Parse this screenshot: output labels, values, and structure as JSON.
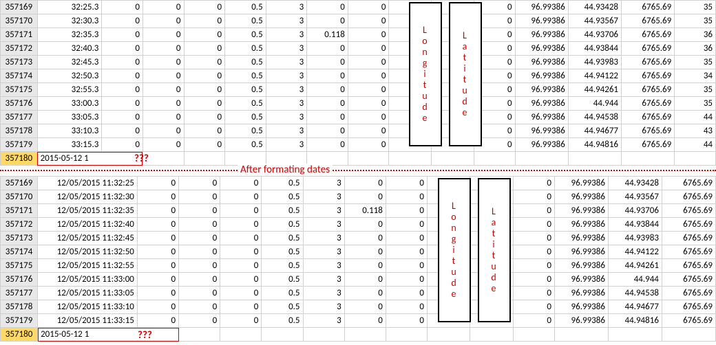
{
  "labels": {
    "after_formatting": "After formating dates",
    "longitude": "Longitude",
    "latitude": "Latitude",
    "question": "???"
  },
  "top": {
    "rows": [
      {
        "r": "357169",
        "t": "32:25.3",
        "a": "0",
        "b": "0",
        "c": "0",
        "d": "0.5",
        "e": "3",
        "f": "0",
        "g": "0",
        "h": "",
        "i": "",
        "j": "0",
        "k": "96.99386",
        "l": "44.93428",
        "m": "6765.69",
        "n": "35"
      },
      {
        "r": "357170",
        "t": "32:30.3",
        "a": "0",
        "b": "0",
        "c": "0",
        "d": "0.5",
        "e": "3",
        "f": "0",
        "g": "0",
        "h": "",
        "i": "",
        "j": "0",
        "k": "96.99386",
        "l": "44.93567",
        "m": "6765.69",
        "n": "35"
      },
      {
        "r": "357171",
        "t": "32:35.3",
        "a": "0",
        "b": "0",
        "c": "0",
        "d": "0.5",
        "e": "3",
        "f": "0.118",
        "g": "0",
        "h": "",
        "i": "",
        "j": "0",
        "k": "96.99386",
        "l": "44.93706",
        "m": "6765.69",
        "n": "36"
      },
      {
        "r": "357172",
        "t": "32:40.3",
        "a": "0",
        "b": "0",
        "c": "0",
        "d": "0.5",
        "e": "3",
        "f": "0",
        "g": "0",
        "h": "",
        "i": "",
        "j": "0",
        "k": "96.99386",
        "l": "44.93844",
        "m": "6765.69",
        "n": "36"
      },
      {
        "r": "357173",
        "t": "32:45.3",
        "a": "0",
        "b": "0",
        "c": "0",
        "d": "0.5",
        "e": "3",
        "f": "0",
        "g": "0",
        "h": "",
        "i": "",
        "j": "0",
        "k": "96.99386",
        "l": "44.93983",
        "m": "6765.69",
        "n": "35"
      },
      {
        "r": "357174",
        "t": "32:50.3",
        "a": "0",
        "b": "0",
        "c": "0",
        "d": "0.5",
        "e": "3",
        "f": "0",
        "g": "0",
        "h": "",
        "i": "",
        "j": "0",
        "k": "96.99386",
        "l": "44.94122",
        "m": "6765.69",
        "n": "34"
      },
      {
        "r": "357175",
        "t": "32:55.3",
        "a": "0",
        "b": "0",
        "c": "0",
        "d": "0.5",
        "e": "3",
        "f": "0",
        "g": "0",
        "h": "",
        "i": "",
        "j": "0",
        "k": "96.99386",
        "l": "44.94261",
        "m": "6765.69",
        "n": "35"
      },
      {
        "r": "357176",
        "t": "33:00.3",
        "a": "0",
        "b": "0",
        "c": "0",
        "d": "0.5",
        "e": "3",
        "f": "0",
        "g": "0",
        "h": "",
        "i": "",
        "j": "0",
        "k": "96.99386",
        "l": "44.944",
        "m": "6765.69",
        "n": "35"
      },
      {
        "r": "357177",
        "t": "33:05.3",
        "a": "0",
        "b": "0",
        "c": "0",
        "d": "0.5",
        "e": "3",
        "f": "0",
        "g": "0",
        "h": "",
        "i": "",
        "j": "0",
        "k": "96.99386",
        "l": "44.94538",
        "m": "6765.69",
        "n": "44"
      },
      {
        "r": "357178",
        "t": "33:10.3",
        "a": "0",
        "b": "0",
        "c": "0",
        "d": "0.5",
        "e": "3",
        "f": "0",
        "g": "0",
        "h": "",
        "i": "",
        "j": "0",
        "k": "96.99386",
        "l": "44.94677",
        "m": "6765.69",
        "n": "43"
      },
      {
        "r": "357179",
        "t": "33:15.3",
        "a": "0",
        "b": "0",
        "c": "0",
        "d": "0.5",
        "e": "3",
        "f": "0",
        "g": "0",
        "h": "",
        "i": "",
        "j": "0",
        "k": "96.99386",
        "l": "44.94816",
        "m": "6765.69",
        "n": "44"
      }
    ],
    "last": {
      "r": "357180",
      "t": "2015-05-12 1"
    }
  },
  "bottom": {
    "rows": [
      {
        "r": "357169",
        "t": "12/05/2015 11:32:25",
        "a": "0",
        "b": "0",
        "c": "0",
        "d": "0.5",
        "e": "3",
        "f": "0",
        "g": "0",
        "h": "",
        "i": "",
        "j": "0",
        "k": "96.99386",
        "l": "44.93428",
        "m": "6765.69"
      },
      {
        "r": "357170",
        "t": "12/05/2015 11:32:30",
        "a": "0",
        "b": "0",
        "c": "0",
        "d": "0.5",
        "e": "3",
        "f": "0",
        "g": "0",
        "h": "",
        "i": "",
        "j": "0",
        "k": "96.99386",
        "l": "44.93567",
        "m": "6765.69"
      },
      {
        "r": "357171",
        "t": "12/05/2015 11:32:35",
        "a": "0",
        "b": "0",
        "c": "0",
        "d": "0.5",
        "e": "3",
        "f": "0.118",
        "g": "0",
        "h": "",
        "i": "",
        "j": "0",
        "k": "96.99386",
        "l": "44.93706",
        "m": "6765.69"
      },
      {
        "r": "357172",
        "t": "12/05/2015 11:32:40",
        "a": "0",
        "b": "0",
        "c": "0",
        "d": "0.5",
        "e": "3",
        "f": "0",
        "g": "0",
        "h": "",
        "i": "",
        "j": "0",
        "k": "96.99386",
        "l": "44.93844",
        "m": "6765.69"
      },
      {
        "r": "357173",
        "t": "12/05/2015 11:32:45",
        "a": "0",
        "b": "0",
        "c": "0",
        "d": "0.5",
        "e": "3",
        "f": "0",
        "g": "0",
        "h": "",
        "i": "",
        "j": "0",
        "k": "96.99386",
        "l": "44.93983",
        "m": "6765.69"
      },
      {
        "r": "357174",
        "t": "12/05/2015 11:32:50",
        "a": "0",
        "b": "0",
        "c": "0",
        "d": "0.5",
        "e": "3",
        "f": "0",
        "g": "0",
        "h": "",
        "i": "",
        "j": "0",
        "k": "96.99386",
        "l": "44.94122",
        "m": "6765.69"
      },
      {
        "r": "357175",
        "t": "12/05/2015 11:32:55",
        "a": "0",
        "b": "0",
        "c": "0",
        "d": "0.5",
        "e": "3",
        "f": "0",
        "g": "0",
        "h": "",
        "i": "",
        "j": "0",
        "k": "96.99386",
        "l": "44.94261",
        "m": "6765.69"
      },
      {
        "r": "357176",
        "t": "12/05/2015 11:33:00",
        "a": "0",
        "b": "0",
        "c": "0",
        "d": "0.5",
        "e": "3",
        "f": "0",
        "g": "0",
        "h": "",
        "i": "",
        "j": "0",
        "k": "96.99386",
        "l": "44.944",
        "m": "6765.69"
      },
      {
        "r": "357177",
        "t": "12/05/2015 11:33:05",
        "a": "0",
        "b": "0",
        "c": "0",
        "d": "0.5",
        "e": "3",
        "f": "0",
        "g": "0",
        "h": "",
        "i": "",
        "j": "0",
        "k": "96.99386",
        "l": "44.94538",
        "m": "6765.69"
      },
      {
        "r": "357178",
        "t": "12/05/2015 11:33:10",
        "a": "0",
        "b": "0",
        "c": "0",
        "d": "0.5",
        "e": "3",
        "f": "0",
        "g": "0",
        "h": "",
        "i": "",
        "j": "0",
        "k": "96.99386",
        "l": "44.94677",
        "m": "6765.69"
      },
      {
        "r": "357179",
        "t": "12/05/2015 11:33:15",
        "a": "0",
        "b": "0",
        "c": "0",
        "d": "0.5",
        "e": "3",
        "f": "0",
        "g": "0",
        "h": "",
        "i": "",
        "j": "0",
        "k": "96.99386",
        "l": "44.94816",
        "m": "6765.69"
      }
    ],
    "last": {
      "r": "357180",
      "t": "2015-05-12 1"
    }
  }
}
